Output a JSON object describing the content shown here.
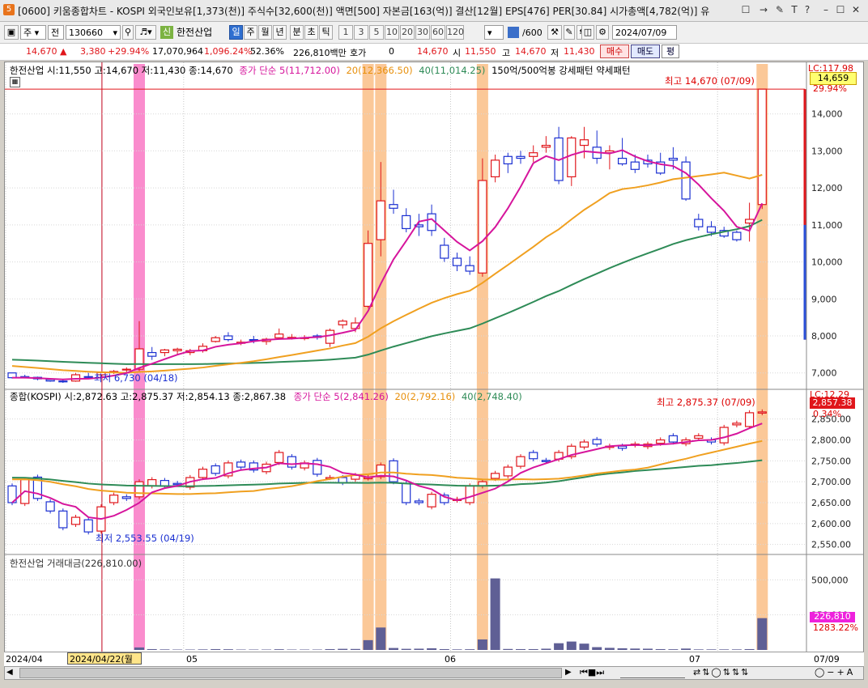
{
  "window": {
    "icon": "5",
    "title": "[0600] 키움종합차트 - KOSPI 외국인보유[1,373(천)] 주식수[32,600(천)] 액면[500] 자본금[163(억)] 결산[12월] EPS[476] PER[30.84] 시가총액[4,782(억)] 유",
    "buttons": [
      "☐",
      "→",
      "✎",
      "T",
      "?",
      "–",
      "☐",
      "✕"
    ]
  },
  "toolbar": {
    "type_select": "주",
    "range_select": "전",
    "code": "130660",
    "stock_badge": "신",
    "stock_name": "한전산업",
    "periods": [
      "일",
      "주",
      "월",
      "년",
      "분",
      "초",
      "틱"
    ],
    "selected_period": "일",
    "numbers": [
      "1",
      "3",
      "5",
      "10",
      "20",
      "30",
      "60",
      "120"
    ],
    "count": "/600",
    "date": "2024/07/09"
  },
  "pricebar": {
    "price": "14,670",
    "change": "3,380",
    "change_pct": "+29.94%",
    "volume": "17,070,964",
    "volume_pct": "1,096.24%",
    "turnover_pct": "52.36%",
    "amount": "226,810백만",
    "quote_label": "호가",
    "quote_value": "0",
    "current": "14,670",
    "open_label": "시",
    "open": "11,550",
    "high_label": "고",
    "high": "14,670",
    "low_label": "저",
    "low": "11,430",
    "buy_label": "매수",
    "sell_label": "매도",
    "avg_label": "평"
  },
  "pane1": {
    "header_a": "한전산업 시:11,550 고:14,670 저:11,430 종:14,670",
    "header_b": "종가 단순 5(11,712.00)",
    "header_c": "20(12,366.50)",
    "header_d": "40(11,014.25)",
    "header_e": "150억/500억봉 강세패턴 약세패턴",
    "lc": "LC:117.98",
    "last_price": "14,659",
    "last_pct": "29.94%",
    "high_note": "최고 14,670 (07/09)",
    "low_note": "최저 6,730 (04/18)",
    "y_ticks": [
      "14,000",
      "13,000",
      "12,000",
      "11,000",
      "10,000",
      "9,000",
      "8,000",
      "7,000"
    ]
  },
  "pane2": {
    "header_a": "종합(KOSPI) 시:2,872.63 고:2,875.37 저:2,854.13 종:2,867.38",
    "header_b": "종가 단순 5(2,841.26)",
    "header_c": "20(2,792.16)",
    "header_d": "40(2,748.40)",
    "lc": "LC:12.29",
    "last_price": "2,857.38",
    "last_pct": "0.34%",
    "high_note": "최고 2,875.37 (07/09)",
    "low_note": "최저 2,553.55 (04/19)",
    "y_ticks": [
      "2,850.00",
      "2,800.00",
      "2,750.00",
      "2,700.00",
      "2,650.00",
      "2,600.00",
      "2,550.00"
    ]
  },
  "pane3": {
    "header": "한전산업 거래대금(226,810.00)",
    "last_value": "226,810",
    "last_pct": "1283.22%",
    "y_ticks": [
      "500,000",
      "250,000"
    ]
  },
  "datebar": {
    "start": "2024/04",
    "cursor": "2024/04/22(월",
    "m05": "05",
    "m06": "06",
    "m07": "07",
    "end": "07/09"
  },
  "colors": {
    "up": "#e0161b",
    "down": "#1a2fd1",
    "ma5": "#d6159c",
    "ma20": "#f0a020",
    "ma40": "#2e8b57",
    "highlight_orange": "#fbc898",
    "highlight_pink": "#fa8ccd",
    "volume_bar": "#5f5f95"
  },
  "chart_data": {
    "type": "candlestick",
    "stock": {
      "name": "한전산업",
      "dates_shown": [
        "2024/04",
        "05",
        "06",
        "07"
      ],
      "ohlc": [
        [
          7000,
          6950,
          6850,
          6870
        ],
        [
          6900,
          6950,
          6850,
          6870
        ],
        [
          6880,
          6900,
          6800,
          6840
        ],
        [
          6820,
          6850,
          6760,
          6780
        ],
        [
          6780,
          6830,
          6730,
          6760
        ],
        [
          6780,
          7000,
          6760,
          6950
        ],
        [
          6900,
          7000,
          6860,
          6880
        ],
        [
          6950,
          7030,
          6900,
          7010
        ],
        [
          7020,
          7080,
          6970,
          7040
        ],
        [
          7080,
          7150,
          7020,
          7100
        ],
        [
          7100,
          8400,
          7050,
          7650
        ],
        [
          7550,
          7700,
          7350,
          7450
        ],
        [
          7550,
          7650,
          7450,
          7620
        ],
        [
          7600,
          7680,
          7500,
          7640
        ],
        [
          7550,
          7650,
          7480,
          7600
        ],
        [
          7600,
          7800,
          7550,
          7720
        ],
        [
          7850,
          8000,
          7820,
          7950
        ],
        [
          8000,
          8100,
          7850,
          7900
        ],
        [
          7800,
          7900,
          7750,
          7830
        ],
        [
          7900,
          8000,
          7800,
          7880
        ],
        [
          7850,
          7950,
          7760,
          7910
        ],
        [
          7950,
          8200,
          7900,
          8050
        ],
        [
          7950,
          8050,
          7900,
          7960
        ],
        [
          7950,
          8020,
          7880,
          7950
        ],
        [
          8000,
          8050,
          7900,
          7960
        ],
        [
          7800,
          8200,
          7700,
          8150
        ],
        [
          8300,
          8450,
          8200,
          8400
        ],
        [
          8200,
          8500,
          8100,
          8350
        ],
        [
          8800,
          10850,
          8750,
          10500
        ],
        [
          10600,
          12700,
          10150,
          11650
        ],
        [
          11550,
          11950,
          11300,
          11450
        ],
        [
          11250,
          11450,
          10800,
          10900
        ],
        [
          11000,
          11300,
          10700,
          10950
        ],
        [
          11300,
          11550,
          10700,
          10850
        ],
        [
          10450,
          10650,
          10000,
          10100
        ],
        [
          10100,
          10250,
          9750,
          9900
        ],
        [
          9900,
          10150,
          9650,
          9750
        ],
        [
          9700,
          12800,
          9600,
          12200
        ],
        [
          12300,
          12900,
          12150,
          12750
        ],
        [
          12850,
          12950,
          12400,
          12650
        ],
        [
          12850,
          13000,
          12650,
          12800
        ],
        [
          12850,
          13150,
          12700,
          12950
        ],
        [
          13100,
          13400,
          12950,
          13150
        ],
        [
          13350,
          13650,
          12100,
          12200
        ],
        [
          12300,
          13400,
          12050,
          13350
        ],
        [
          13150,
          13650,
          12800,
          13300
        ],
        [
          13100,
          13550,
          12650,
          12800
        ],
        [
          12950,
          13150,
          12500,
          13000
        ],
        [
          12800,
          13350,
          12600,
          12650
        ],
        [
          12700,
          12900,
          12400,
          12500
        ],
        [
          12750,
          12900,
          12550,
          12650
        ],
        [
          12700,
          12950,
          12350,
          12400
        ],
        [
          12800,
          13100,
          12500,
          12750
        ],
        [
          12700,
          12850,
          11650,
          11700
        ],
        [
          11150,
          11300,
          10850,
          10950
        ],
        [
          10950,
          11100,
          10700,
          10800
        ],
        [
          10850,
          10950,
          10650,
          10700
        ],
        [
          10800,
          10850,
          10550,
          10600
        ],
        [
          11050,
          11600,
          10550,
          11150
        ],
        [
          11550,
          14670,
          11430,
          14670
        ]
      ],
      "ma5_final": 11712.0,
      "ma20_final": 12366.5,
      "ma40_final": 11014.25,
      "highlight_days": [
        10,
        28,
        29,
        37,
        59
      ],
      "y_range": [
        6600,
        15000
      ]
    },
    "kospi": {
      "name": "종합(KOSPI)",
      "closes": [
        2650,
        2705,
        2660,
        2630,
        2590,
        2615,
        2580,
        2640,
        2668,
        2660,
        2700,
        2705,
        2690,
        2695,
        2710,
        2730,
        2720,
        2745,
        2735,
        2728,
        2742,
        2770,
        2735,
        2745,
        2718,
        2710,
        2698,
        2715,
        2710,
        2740,
        2700,
        2650,
        2650,
        2670,
        2650,
        2658,
        2690,
        2700,
        2720,
        2735,
        2760,
        2755,
        2750,
        2770,
        2785,
        2795,
        2790,
        2785,
        2780,
        2790,
        2790,
        2800,
        2795,
        2800,
        2810,
        2795,
        2830,
        2840,
        2865,
        2867
      ],
      "ma5_final": 2841.26,
      "ma20_final": 2792.16,
      "ma40_final": 2748.4,
      "y_range": [
        2530,
        2890
      ]
    },
    "turnover": {
      "name": "한전산업 거래대금",
      "values": [
        0,
        0,
        0,
        0,
        0,
        0,
        0,
        0,
        0,
        0,
        18000,
        6000,
        4000,
        3000,
        3000,
        4000,
        6000,
        5000,
        3000,
        3000,
        3000,
        5000,
        3000,
        3000,
        3000,
        6000,
        8000,
        7000,
        70000,
        160000,
        14000,
        8000,
        9000,
        12000,
        6000,
        4000,
        5000,
        75000,
        510000,
        7000,
        6000,
        6000,
        9000,
        48000,
        60000,
        45000,
        20000,
        15000,
        12000,
        10000,
        9000,
        6000,
        5000,
        10000,
        4000,
        4000,
        4000,
        4000,
        6000,
        226810
      ],
      "y_range": [
        0,
        600000
      ]
    }
  }
}
